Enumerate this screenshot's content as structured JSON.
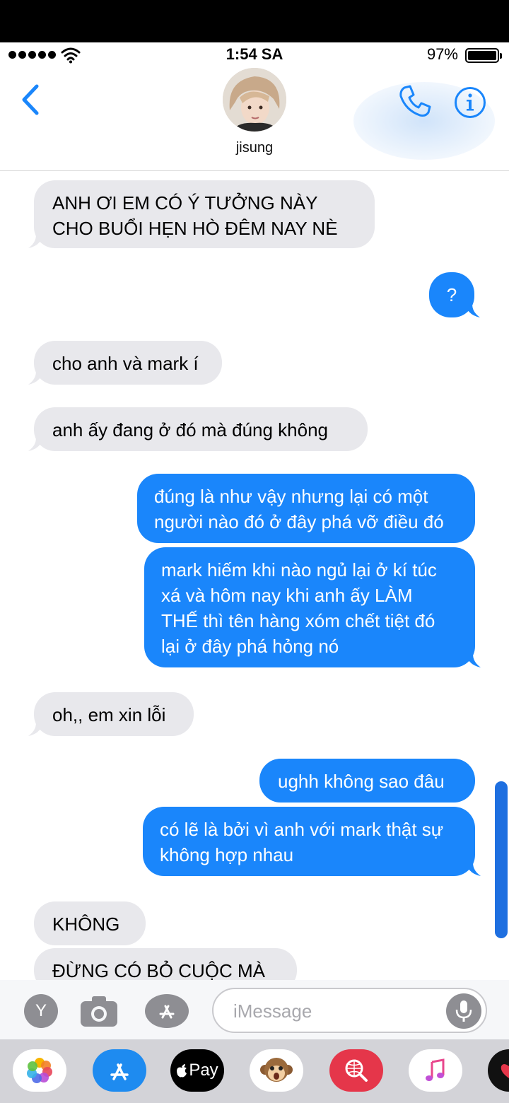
{
  "status_bar": {
    "time": "1:54 SA",
    "battery": "97%"
  },
  "header": {
    "contact_name": "jisung"
  },
  "messages": [
    {
      "dir": "in",
      "text": "ANH ƠI EM CÓ Ý TƯỞNG NÀY\nCHO BUỔI HẸN HÒ ĐÊM NAY NÈ"
    },
    {
      "dir": "out",
      "text": "?"
    },
    {
      "dir": "in",
      "text": "cho anh và mark í"
    },
    {
      "dir": "in",
      "text": "anh ấy đang ở đó mà đúng không"
    },
    {
      "dir": "out",
      "text": "đúng là như vậy nhưng lại có một\nngười nào đó ở đây phá vỡ điều đó"
    },
    {
      "dir": "out",
      "text": "mark hiếm khi nào ngủ lại ở kí túc\nxá và hôm nay khi anh ấy LÀM\nTHẾ thì tên hàng xóm chết tiệt đó\nlại ở đây phá hỏng nó"
    },
    {
      "dir": "in",
      "text": "oh,, em xin lỗi"
    },
    {
      "dir": "out",
      "text": "ughh không sao đâu"
    },
    {
      "dir": "out",
      "text": "có lẽ là bởi vì anh với mark thật sự\nkhông hợp nhau"
    },
    {
      "dir": "in",
      "text": "KHÔNG"
    },
    {
      "dir": "in",
      "text": "ĐỪNG CÓ BỎ CUỘC MÀ"
    }
  ],
  "input": {
    "placeholder": "iMessage",
    "apps_button_letter": "Y"
  },
  "drawer": {
    "apps": [
      "photos-app",
      "app-store-app",
      "apple-pay-app",
      "animoji-app",
      "web-search-app",
      "music-app",
      "digital-touch-app"
    ],
    "apple_pay_label": "Pay"
  }
}
